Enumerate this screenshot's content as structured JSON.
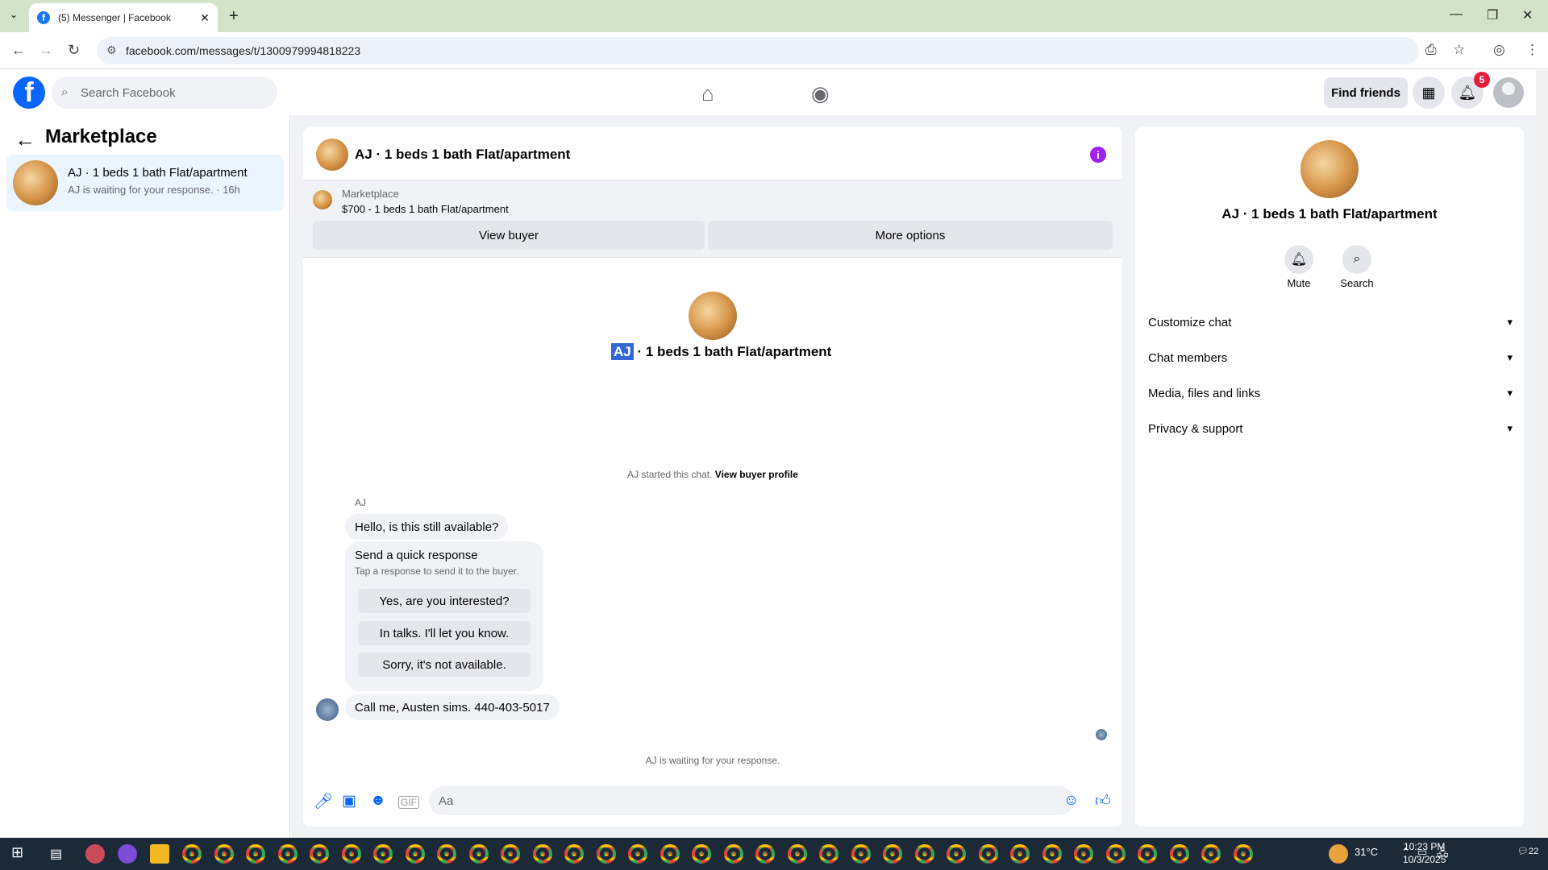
{
  "browser": {
    "tab_title": "(5) Messenger | Facebook",
    "url": "facebook.com/messages/t/1300979994818223",
    "new_tab": "+",
    "tab_close": "✕"
  },
  "fb_header": {
    "logo": "f",
    "search_placeholder": "Search Facebook",
    "find_friends": "Find friends",
    "notification_count": "5"
  },
  "sidebar": {
    "title": "Marketplace",
    "conversation": {
      "name": "AJ · 1 beds 1 bath Flat/apartment",
      "preview": "AJ is waiting for your response. · 16h"
    }
  },
  "chat": {
    "title": "AJ · 1 beds 1 bath Flat/apartment",
    "marketplace_label": "Marketplace",
    "listing": "$700 - 1 beds 1 bath Flat/apartment",
    "view_buyer": "View buyer",
    "more_options": "More options",
    "center_name_highlight": "AJ",
    "center_name_rest": " · 1 beds 1 bath Flat/apartment",
    "started_text": "AJ started this chat.",
    "view_buyer_profile": "View buyer profile",
    "sender": "AJ",
    "message1": "Hello, is this still available?",
    "quick_title": "Send a quick response",
    "quick_sub": "Tap a response to send it to the buyer.",
    "quick_responses": [
      "Yes, are you interested?",
      "In talks. I'll let you know.",
      "Sorry, it's not available."
    ],
    "message2": "Call me, Austen sims. 440-403-5017",
    "waiting": "AJ is waiting for your response.",
    "composer_placeholder": "Aa"
  },
  "right_panel": {
    "name": "AJ · 1 beds 1 bath Flat/apartment",
    "mute": "Mute",
    "search": "Search",
    "sections": [
      "Customize chat",
      "Chat members",
      "Media, files and links",
      "Privacy & support"
    ]
  },
  "taskbar": {
    "temperature": "31°C",
    "time": "10:23 PM",
    "date": "10/3/2025",
    "notif_count": "22"
  },
  "icons": {
    "home": "home-icon",
    "groups": "groups-icon",
    "menu": "grid-icon",
    "bell": "bell-icon"
  },
  "colors": {
    "brand": "#0866ff",
    "badge": "#e41e3f",
    "info": "#a020f0",
    "selected_item": "#ebf5ff"
  }
}
